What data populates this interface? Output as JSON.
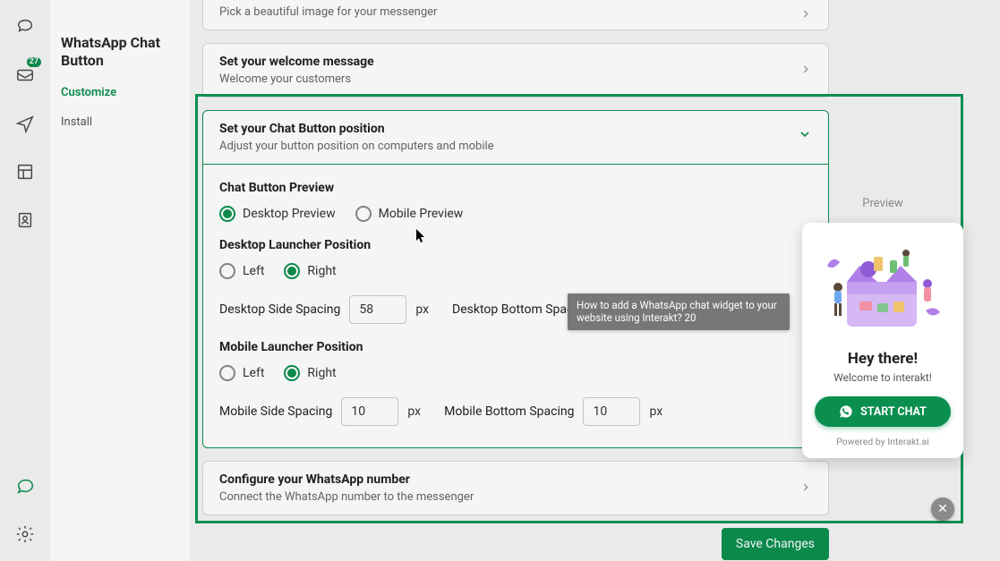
{
  "rail_badge": "27",
  "side": {
    "title": "WhatsApp Chat Button",
    "customize": "Customize",
    "install": "Install"
  },
  "cards": {
    "image": {
      "title": "",
      "sub": "Pick a beautiful image for your messenger"
    },
    "welcome": {
      "title": "Set your welcome message",
      "sub": "Welcome your customers"
    },
    "number": {
      "title": "Configure your WhatsApp number",
      "sub": "Connect the WhatsApp number to the messenger"
    }
  },
  "position": {
    "title": "Set your Chat Button position",
    "sub": "Adjust your button position on computers and mobile",
    "preview_section": "Chat Button Preview",
    "desktop_preview": "Desktop Preview",
    "mobile_preview": "Mobile Preview",
    "desktop_launcher_label": "Desktop Launcher Position",
    "left": "Left",
    "right": "Right",
    "desktop_side_label": "Desktop Side Spacing",
    "desktop_side_value": "58",
    "desktop_bottom_label": "Desktop Bottom Spacing",
    "mobile_launcher_label": "Mobile Launcher Position",
    "mobile_side_label": "Mobile Side Spacing",
    "mobile_side_value": "10",
    "mobile_bottom_label": "Mobile Bottom Spacing",
    "mobile_bottom_value": "10",
    "px": "px"
  },
  "preview": {
    "label": "Preview",
    "hey": "Hey there!",
    "welcome": "Welcome to interakt!",
    "start": "START CHAT",
    "powered": "Powered by Interakt.ai"
  },
  "tooltip": "How to add a WhatsApp chat widget to your website using Interakt? 20",
  "save": "Save Changes"
}
